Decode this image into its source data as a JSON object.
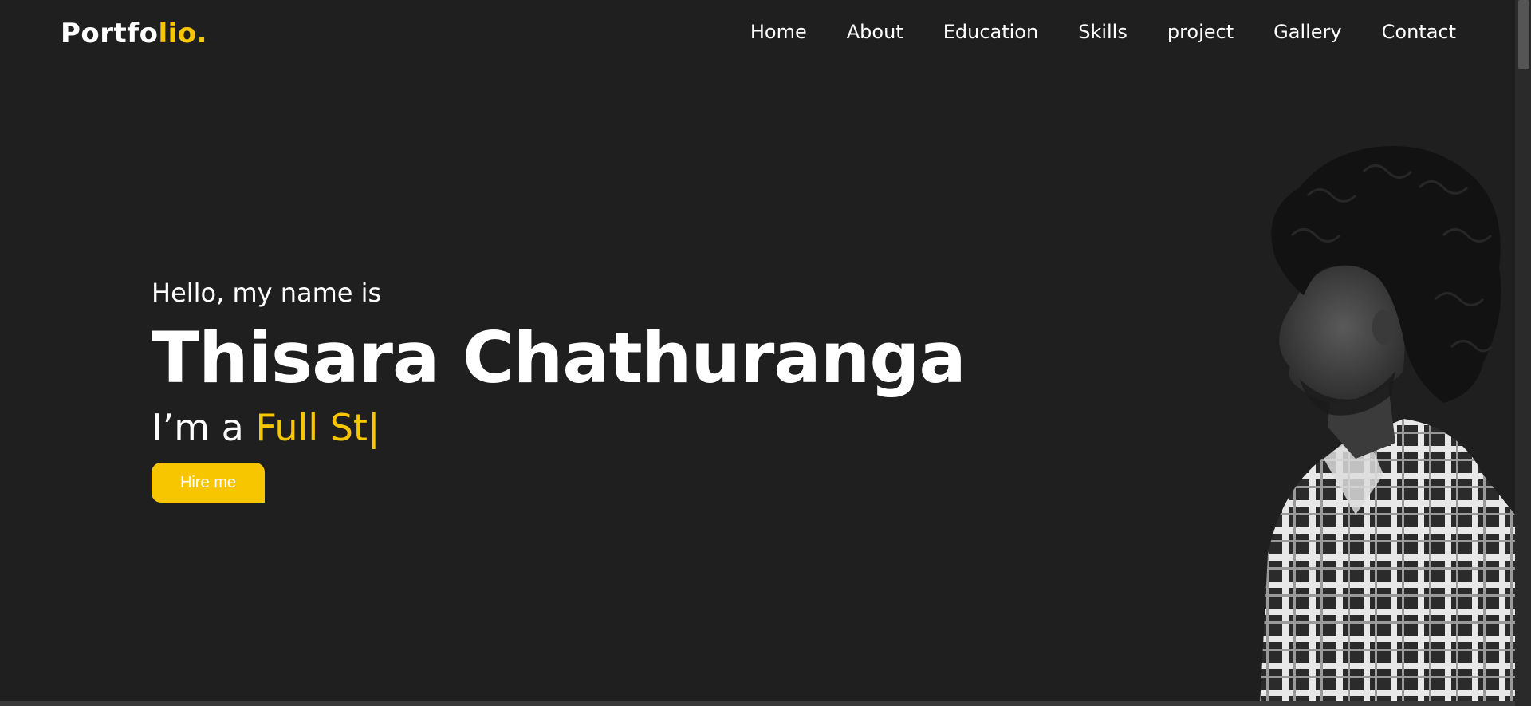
{
  "header": {
    "logo_main": "Portfo",
    "logo_accent": "lio.",
    "nav": [
      {
        "label": "Home"
      },
      {
        "label": "About"
      },
      {
        "label": "Education"
      },
      {
        "label": "Skills"
      },
      {
        "label": "project"
      },
      {
        "label": "Gallery"
      },
      {
        "label": "Contact"
      }
    ]
  },
  "hero": {
    "greeting": "Hello, my name is",
    "name": "Thisara Chathuranga",
    "role_prefix": "I’m a ",
    "role_typed": "Full St",
    "cursor": "|",
    "hire_label": "Hire me"
  },
  "colors": {
    "background": "#1f1f1f",
    "accent": "#f7c600",
    "text": "#ffffff"
  }
}
